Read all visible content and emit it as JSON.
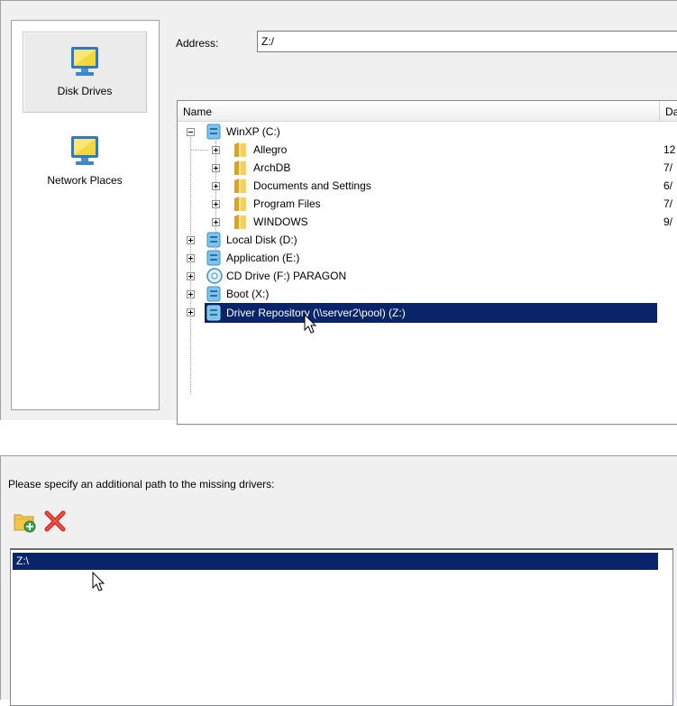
{
  "address_dialog": {
    "places": [
      {
        "label": "Disk Drives",
        "icon": "computer-icon",
        "selected": true
      },
      {
        "label": "Network Places",
        "icon": "network-computer-icon",
        "selected": false
      }
    ],
    "address_label": "Address:",
    "address_value": "Z:/",
    "columns": {
      "name": "Name",
      "date": "Da"
    },
    "tree": [
      {
        "label": "WinXP (C:)",
        "icon": "hard-disk-icon",
        "expanded": true,
        "level": 0,
        "date": ""
      },
      {
        "label": "Allegro",
        "icon": "folder-icon",
        "level": 1,
        "date": "12"
      },
      {
        "label": "ArchDB",
        "icon": "folder-icon",
        "level": 1,
        "date": "7/"
      },
      {
        "label": "Documents and Settings",
        "icon": "folder-icon",
        "level": 1,
        "date": "6/"
      },
      {
        "label": "Program Files",
        "icon": "folder-icon",
        "level": 1,
        "date": "7/"
      },
      {
        "label": "WINDOWS",
        "icon": "folder-icon",
        "level": 1,
        "date": "9/"
      },
      {
        "label": "Local Disk (D:)",
        "icon": "hard-disk-icon",
        "level": 0,
        "date": ""
      },
      {
        "label": "Application (E:)",
        "icon": "hard-disk-icon",
        "level": 0,
        "date": ""
      },
      {
        "label": "CD Drive (F:) PARAGON",
        "icon": "cd-drive-icon",
        "level": 0,
        "date": ""
      },
      {
        "label": "Boot (X:)",
        "icon": "hard-disk-icon",
        "level": 0,
        "date": ""
      },
      {
        "label": "Driver Repository (\\\\server2\\pool) (Z:)",
        "icon": "network-drive-icon",
        "level": 0,
        "date": "",
        "selected": true
      }
    ]
  },
  "drivers_dialog": {
    "prompt": "Please specify an additional path to the missing drivers:",
    "toolbar": [
      {
        "name": "add-path-button",
        "icon": "add-folder-icon"
      },
      {
        "name": "remove-path-button",
        "icon": "delete-icon"
      }
    ],
    "paths": [
      "Z:\\"
    ]
  },
  "colors": {
    "selection": "#0a246a",
    "panel": "#f0f0f0"
  }
}
